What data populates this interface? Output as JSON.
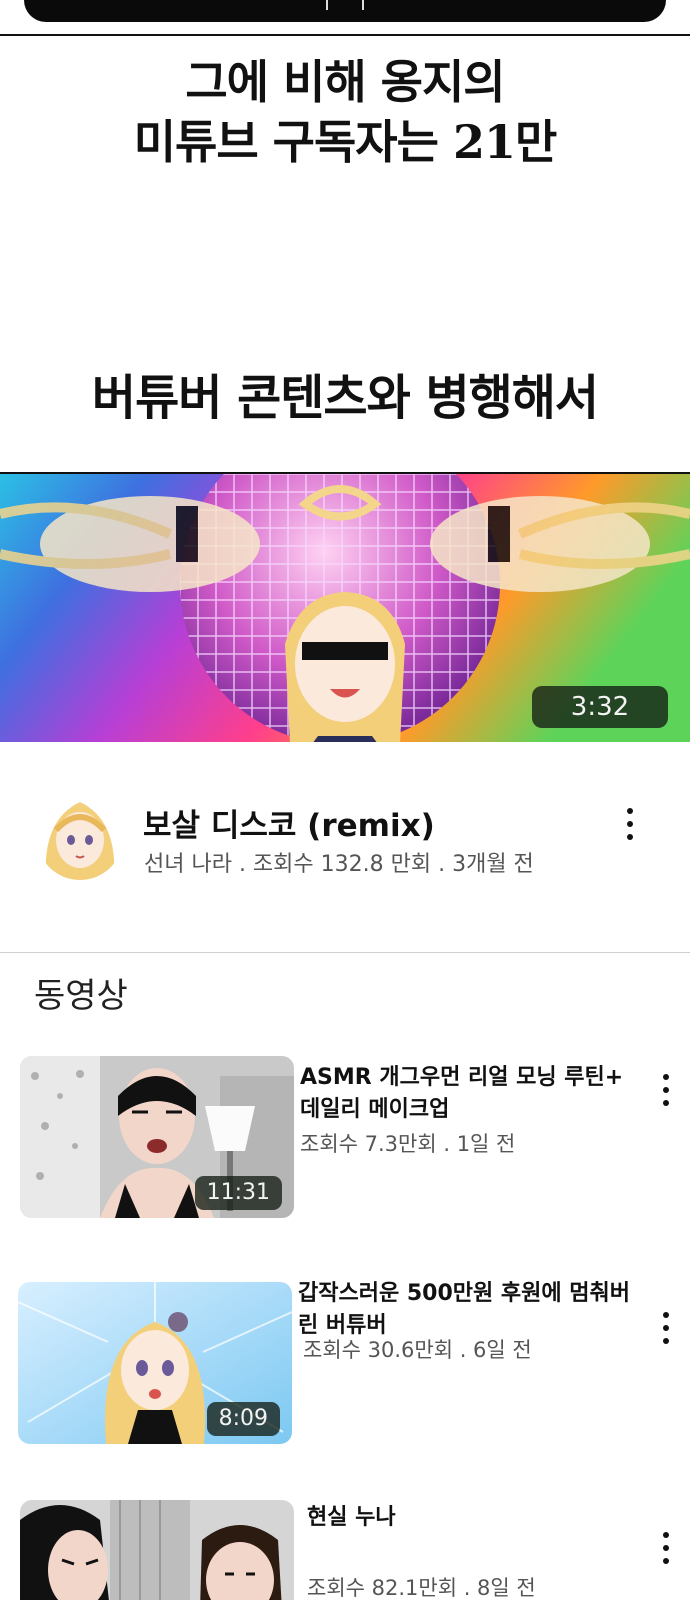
{
  "narration": {
    "line1": "그에 비해 옹지의",
    "line2": "미튜브 구독자는 21만",
    "line3": "버튜버 콘텐츠와 병행해서"
  },
  "featured_video": {
    "duration": "3:32",
    "title": "보살 디스코 (remix)",
    "meta": "선녀 나라  .  조회수 132.8 만회  .  3개월 전"
  },
  "section": {
    "title": "동영상"
  },
  "videos": [
    {
      "title": "ASMR 개그우먼 리얼 모닝 루틴+ 데일리 메이크업",
      "meta": "조회수 7.3만회  .  1일 전",
      "duration": "11:31"
    },
    {
      "title": "갑작스러운 500만원 후원에 멈춰버린 버튜버",
      "meta": "조회수 30.6만회  .  6일 전",
      "duration": "8:09"
    },
    {
      "title": "현실 누나",
      "meta": "조회수 82.1만회  .  8일 전",
      "duration": ""
    }
  ],
  "icons": {
    "more": "more-vert-icon",
    "avatar": "channel-avatar"
  }
}
